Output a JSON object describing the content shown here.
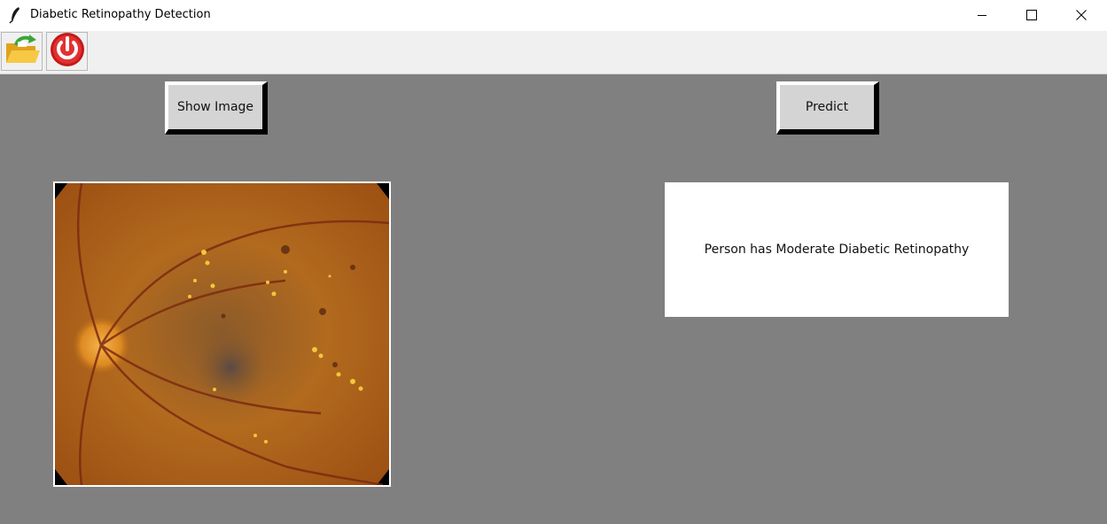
{
  "window": {
    "title": "Diabetic Retinopathy Detection",
    "icon": "feather-icon"
  },
  "toolbar": {
    "buttons": [
      {
        "icon": "open-folder-icon"
      },
      {
        "icon": "power-icon"
      }
    ]
  },
  "actions": {
    "show_image_label": "Show Image",
    "predict_label": "Predict"
  },
  "result": {
    "text": "Person has Moderate Diabetic Retinopathy"
  },
  "colors": {
    "background": "#808080",
    "result_bg": "#ffffff",
    "button_face": "#d4d4d4",
    "power_red": "#d32121"
  }
}
